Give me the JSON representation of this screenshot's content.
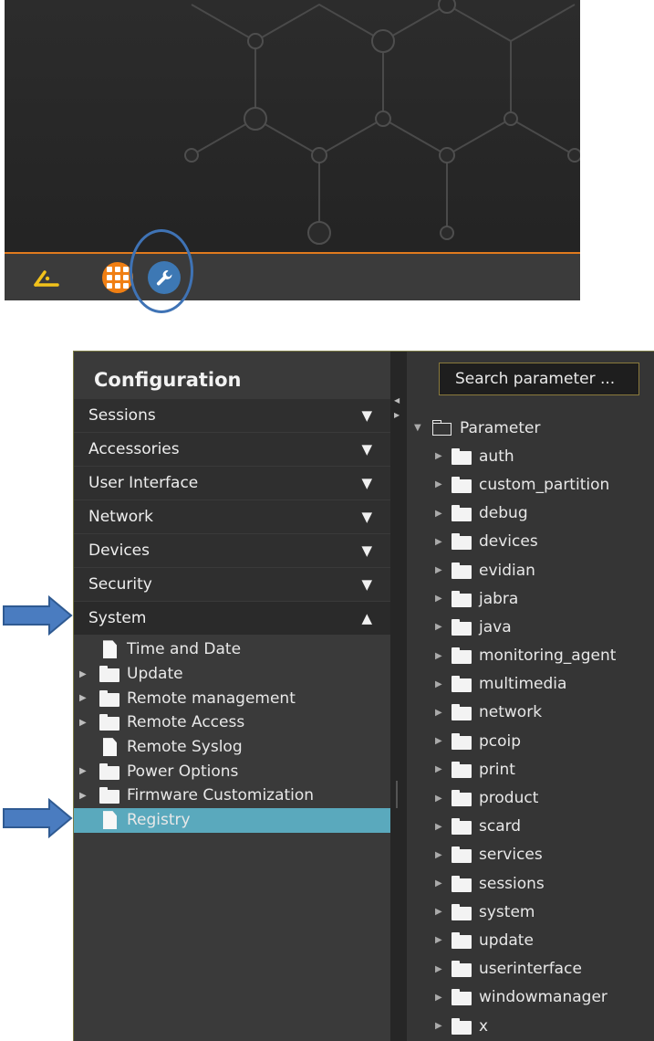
{
  "config": {
    "title": "Configuration",
    "sections": [
      {
        "label": "Sessions",
        "open": false
      },
      {
        "label": "Accessories",
        "open": false
      },
      {
        "label": "User Interface",
        "open": false
      },
      {
        "label": "Network",
        "open": false
      },
      {
        "label": "Devices",
        "open": false
      },
      {
        "label": "Security",
        "open": false
      },
      {
        "label": "System",
        "open": true
      }
    ],
    "system_items": [
      {
        "label": "Time and Date",
        "type": "file",
        "expandable": false
      },
      {
        "label": "Update",
        "type": "folder",
        "expandable": true
      },
      {
        "label": "Remote management",
        "type": "folder",
        "expandable": true
      },
      {
        "label": "Remote Access",
        "type": "folder",
        "expandable": true
      },
      {
        "label": "Remote Syslog",
        "type": "file",
        "expandable": false
      },
      {
        "label": "Power Options",
        "type": "folder",
        "expandable": true
      },
      {
        "label": "Firmware Customization",
        "type": "folder",
        "expandable": true
      },
      {
        "label": "Registry",
        "type": "file",
        "expandable": false,
        "selected": true
      }
    ]
  },
  "search": {
    "placeholder": "Search parameter ..."
  },
  "parameters": {
    "root_label": "Parameter",
    "children": [
      "auth",
      "custom_partition",
      "debug",
      "devices",
      "evidian",
      "jabra",
      "java",
      "monitoring_agent",
      "multimedia",
      "network",
      "pcoip",
      "print",
      "product",
      "scard",
      "services",
      "sessions",
      "system",
      "update",
      "userinterface",
      "windowmanager",
      "x"
    ]
  },
  "taskbar": {
    "icons": [
      "logo-icon",
      "apps-grid-icon",
      "wrench-icon"
    ]
  },
  "colors": {
    "accent_orange": "#f07f13",
    "selection": "#5aa9bd",
    "highlight_circle": "#3f73b5",
    "arrow": "#3f6fae"
  }
}
